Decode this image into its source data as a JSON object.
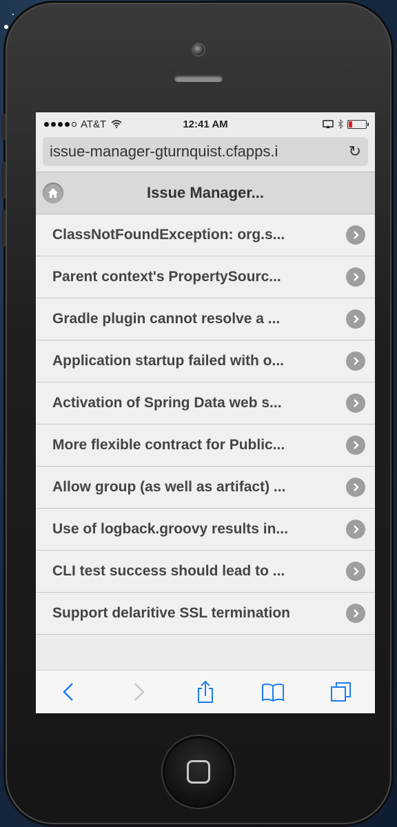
{
  "status_bar": {
    "carrier": "AT&T",
    "time": "12:41 AM"
  },
  "browser": {
    "url": "issue-manager-gturnquist.cfapps.i",
    "reload_icon": "reload-icon"
  },
  "header": {
    "title": "Issue Manager...",
    "home_icon": "home-icon"
  },
  "issues": [
    "ClassNotFoundException: org.s...",
    "Parent context's PropertySourc...",
    "Gradle plugin cannot resolve a ...",
    "Application startup failed with o...",
    "Activation of Spring Data web s...",
    "More flexible contract for Public...",
    "Allow group (as well as artifact) ...",
    "Use of logback.groovy results in...",
    "CLI test success should lead to ...",
    "Support delaritive SSL termination"
  ],
  "toolbar": {
    "icons": [
      "back-icon",
      "forward-icon",
      "share-icon",
      "bookmarks-icon",
      "tabs-icon"
    ]
  },
  "colors": {
    "accent": "#1a7cf0",
    "disabled": "#c6c6c6",
    "battery": "#e02020"
  }
}
